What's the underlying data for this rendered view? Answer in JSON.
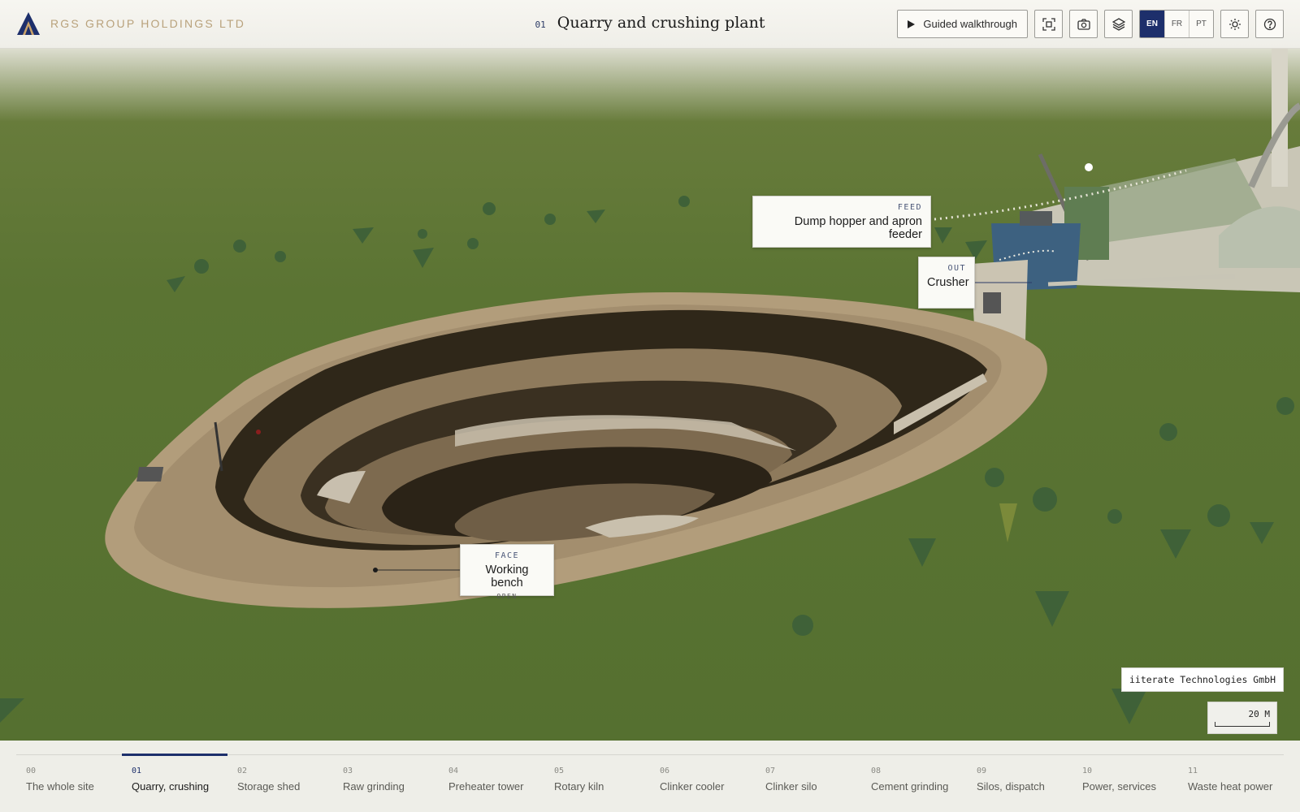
{
  "brand": {
    "name": "RGS GROUP HOLDINGS LTD"
  },
  "header": {
    "section_number": "01",
    "title": "Quarry and crushing plant"
  },
  "toolbar": {
    "walkthrough_label": "Guided walkthrough",
    "icons": [
      "focus-icon",
      "camera-icon",
      "layers-icon",
      "sun-icon",
      "help-icon"
    ],
    "languages": [
      "EN",
      "FR",
      "PT"
    ],
    "active_language": "EN"
  },
  "callouts": {
    "feed": {
      "tag": "FEED",
      "name": "Dump hopper and apron feeder"
    },
    "out": {
      "tag": "OUT",
      "name": "Crusher"
    },
    "face": {
      "tag": "FACE",
      "name": "Working bench",
      "status": "OPEN"
    }
  },
  "credit": "iiterate Technologies GmbH",
  "scale": {
    "label": "20 M"
  },
  "nav": {
    "active_index": 1,
    "items": [
      {
        "num": "00",
        "label": "The whole site"
      },
      {
        "num": "01",
        "label": "Quarry, crushing"
      },
      {
        "num": "02",
        "label": "Storage shed"
      },
      {
        "num": "03",
        "label": "Raw grinding"
      },
      {
        "num": "04",
        "label": "Preheater tower"
      },
      {
        "num": "05",
        "label": "Rotary kiln"
      },
      {
        "num": "06",
        "label": "Clinker cooler"
      },
      {
        "num": "07",
        "label": "Clinker silo"
      },
      {
        "num": "08",
        "label": "Cement grinding"
      },
      {
        "num": "09",
        "label": "Silos, dispatch"
      },
      {
        "num": "10",
        "label": "Power, services"
      },
      {
        "num": "11",
        "label": "Waste heat power"
      }
    ]
  },
  "colors": {
    "accent": "#1d2f6b",
    "brand": "#b9a27c",
    "grass": "#5a7431",
    "quarry_rim": "#b4a07d",
    "quarry_deep": "#3e3222"
  }
}
